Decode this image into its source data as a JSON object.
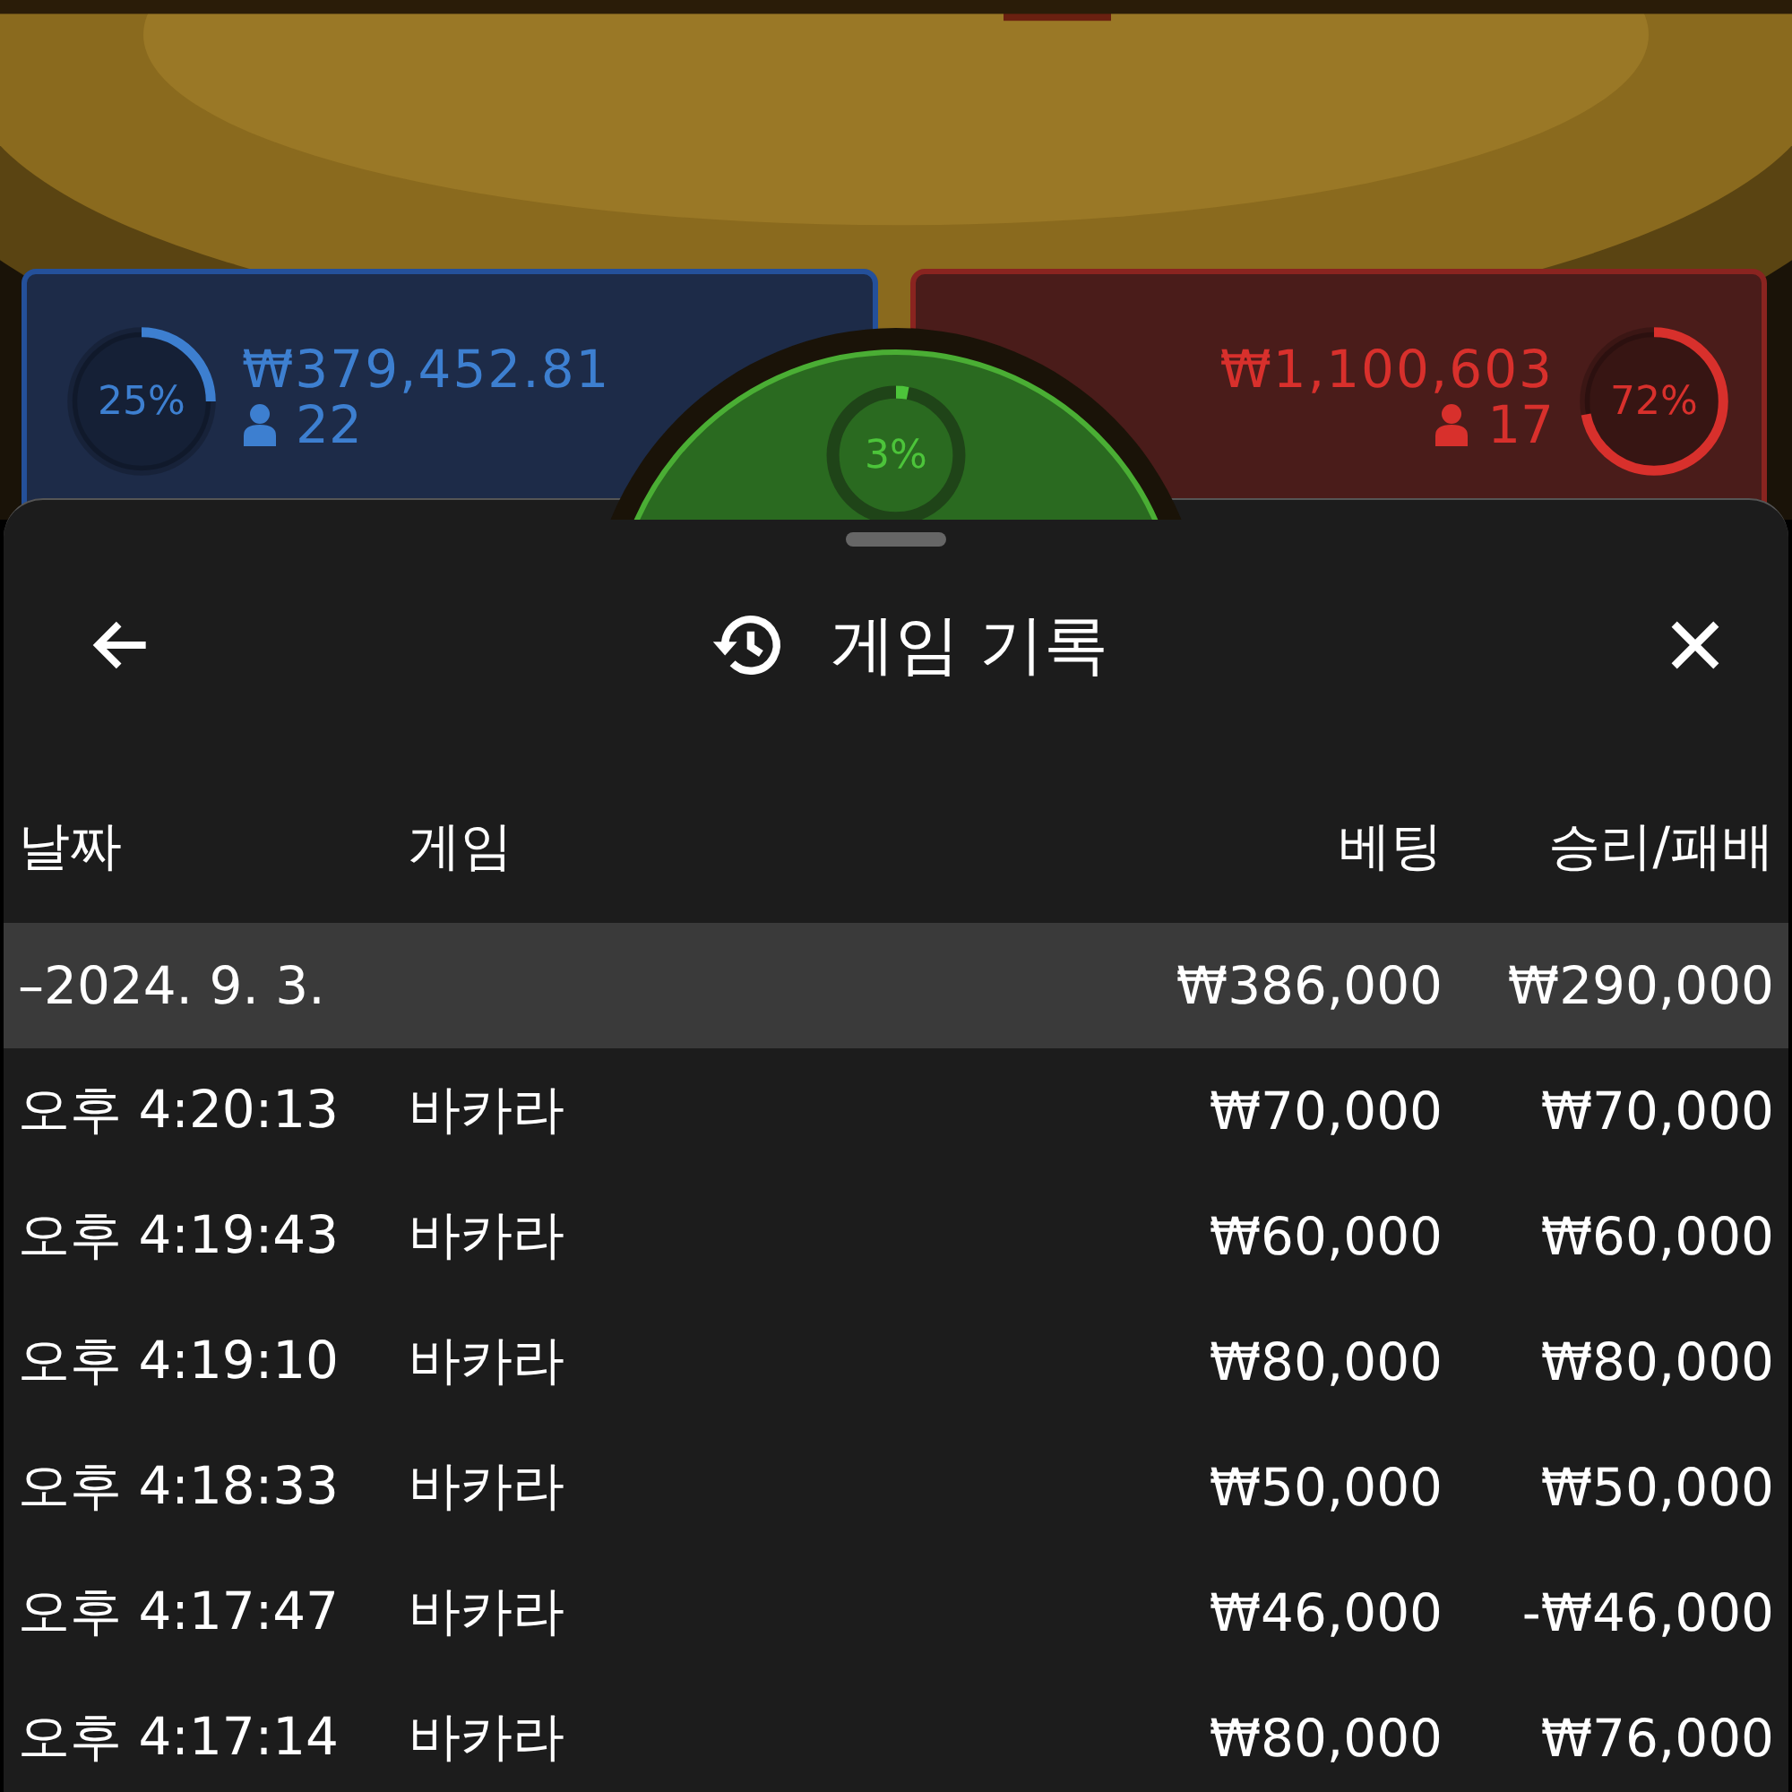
{
  "bets": [
    {
      "kind": "player",
      "percent": "25%",
      "level": 0.25,
      "amount": "₩379,452.81",
      "players": "22"
    },
    {
      "kind": "tie",
      "percent": "3%",
      "level": 0.03
    },
    {
      "kind": "banker",
      "percent": "72%",
      "level": 0.72,
      "amount": "₩1,100,603",
      "players": "17"
    }
  ],
  "sheet": {
    "title": "게임 기록",
    "columns": [
      "날짜",
      "게임",
      "베팅",
      "승리/패배"
    ],
    "group": {
      "date": "–2024. 9. 3.",
      "bet": "₩386,000",
      "result": "₩290,000"
    },
    "rows": [
      {
        "time": "오후 4:20:13",
        "game": "바카라",
        "bet": "₩70,000",
        "result": "₩70,000"
      },
      {
        "time": "오후 4:19:43",
        "game": "바카라",
        "bet": "₩60,000",
        "result": "₩60,000"
      },
      {
        "time": "오후 4:19:10",
        "game": "바카라",
        "bet": "₩80,000",
        "result": "₩80,000"
      },
      {
        "time": "오후 4:18:33",
        "game": "바카라",
        "bet": "₩50,000",
        "result": "₩50,000"
      },
      {
        "time": "오후 4:17:47",
        "game": "바카라",
        "bet": "₩46,000",
        "result": "-₩46,000"
      },
      {
        "time": "오후 4:17:14",
        "game": "바카라",
        "bet": "₩80,000",
        "result": "₩76,000"
      }
    ]
  }
}
